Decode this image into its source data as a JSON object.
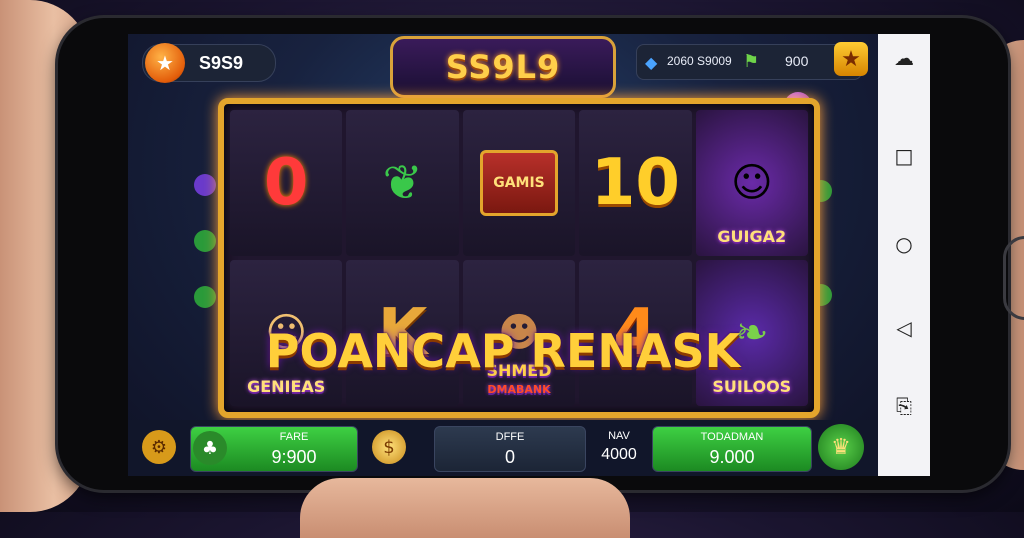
{
  "top_bar": {
    "coin_balance": "S9S9",
    "game_logo": "SS9L9",
    "gem_stat": "2060 S9009",
    "flag_stat": "900"
  },
  "reels": {
    "row1": [
      "0",
      "",
      "GAMIS",
      "10",
      "GUIGA2"
    ],
    "row2": [
      "GENIEAS",
      "K",
      "SHMED",
      "4",
      "SUILOOS"
    ],
    "row2_sub": [
      "",
      "",
      "DMABANK",
      "",
      ""
    ],
    "banner": "POANCAP RENASK"
  },
  "bottom_bar": {
    "left_panel_label": "FARE",
    "left_panel_value": "9:900",
    "middle_panel_label": "DFFE",
    "middle_panel_value": "0",
    "max_label": "NAV",
    "max_value": "4000",
    "right_panel_label": "TODADMAN",
    "right_panel_value": "9.000"
  },
  "colors": {
    "frame_gold": "#e3a52c",
    "green_button": "#3ed043",
    "accent_purple": "#6a1aa8"
  }
}
